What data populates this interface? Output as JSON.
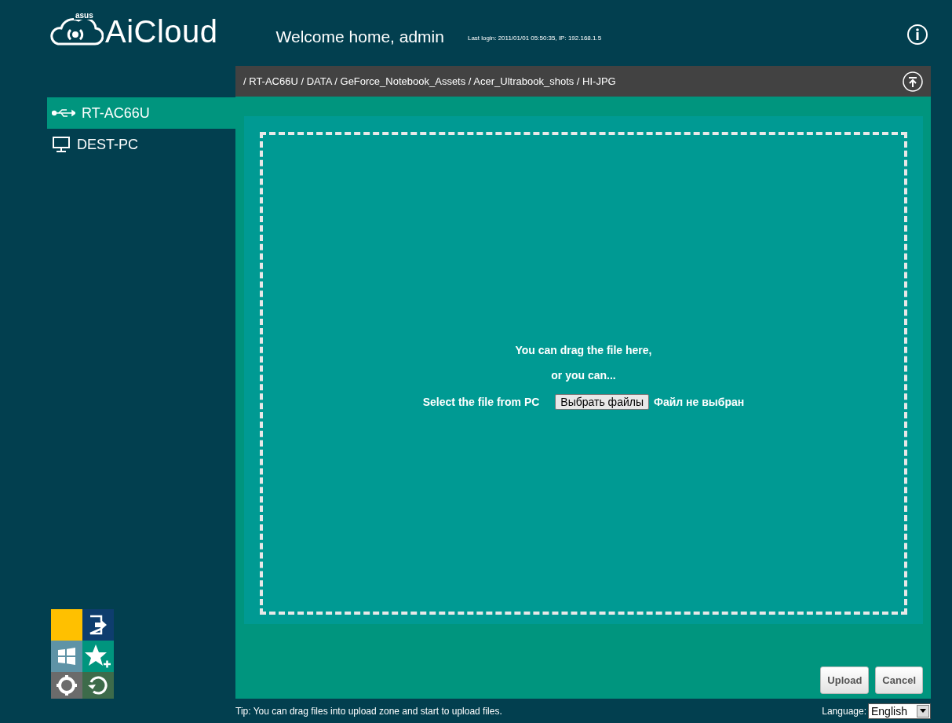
{
  "header": {
    "logo_mark": "asus",
    "logo": "AiCloud",
    "welcome": "Welcome home, admin",
    "last_login": "Last login: 2011/01/01 05:50:35, IP: 192.168.1.5"
  },
  "breadcrumb": "/ RT-AC66U / DATA / GeForce_Notebook_Assets / Acer_Ultrabook_shots / HI-JPG",
  "sidebar": {
    "items": [
      {
        "kind": "usb",
        "label": "RT-AC66U",
        "selected": true
      },
      {
        "kind": "pc",
        "label": "DEST-PC",
        "selected": false
      }
    ]
  },
  "upload": {
    "line_1": "You can drag the file here,",
    "line_2": "or you can...",
    "select_label": "Select the file from PC",
    "file_button": "Выбрать файлы",
    "file_status": "Файл не выбран"
  },
  "buttons": [
    "Upload",
    "Cancel"
  ],
  "tip": "Tip: You can drag files into upload zone and start to upload files.",
  "language": {
    "label": "Language:",
    "value": "English"
  }
}
